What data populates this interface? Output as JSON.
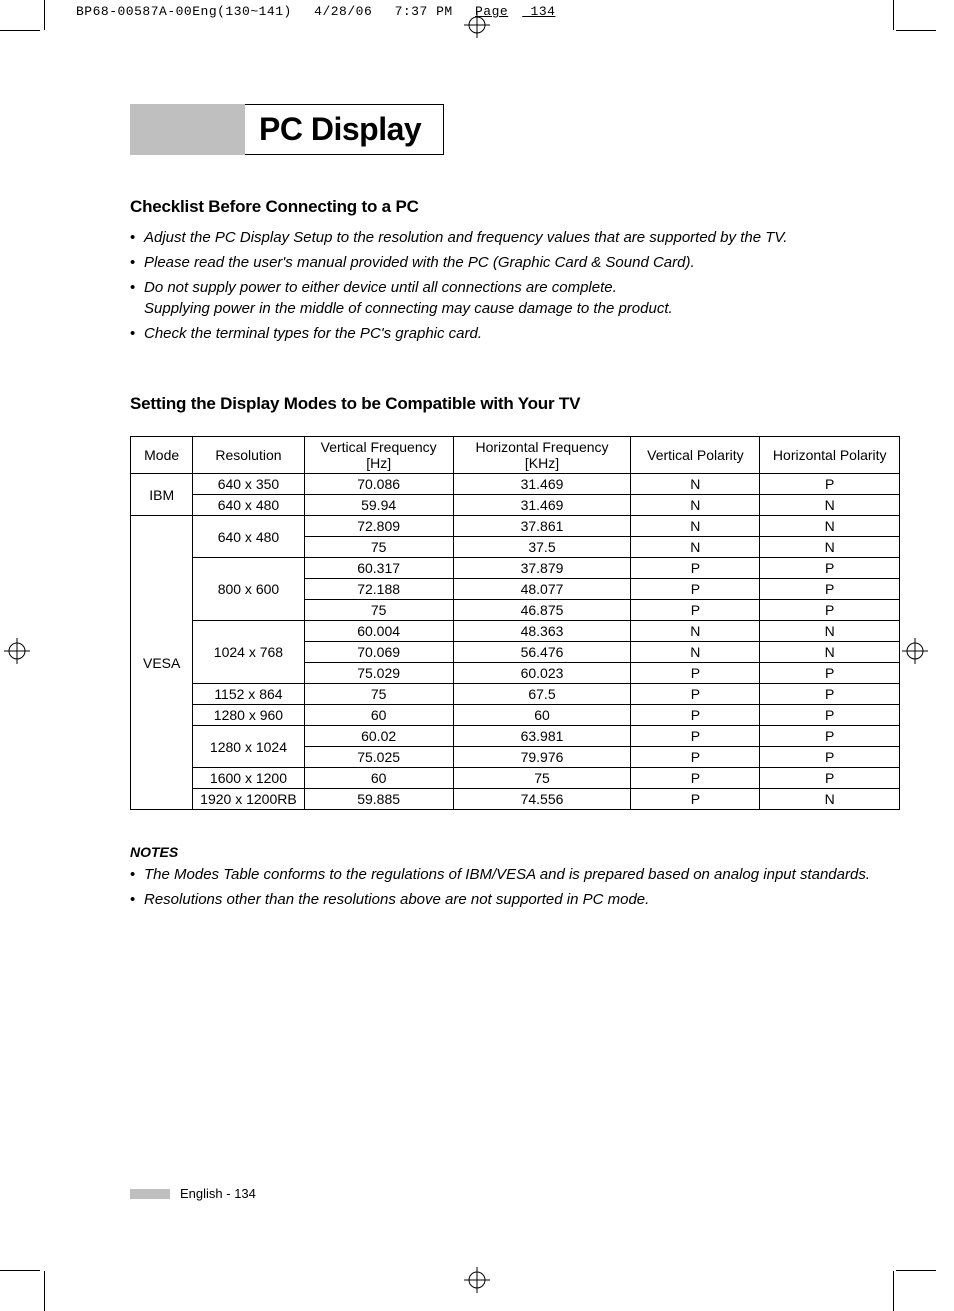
{
  "slug": {
    "file": "BP68-00587A-00Eng(130~141)",
    "date": "4/28/06",
    "time": "7:37 PM",
    "page_label": "Page",
    "page_num": "134"
  },
  "title": "PC Display",
  "checklist_heading": "Checklist Before Connecting to a PC",
  "checklist": [
    "Adjust the PC Display Setup to the resolution and frequency values that are supported by the TV.",
    "Please read the user's manual provided with the PC (Graphic Card & Sound Card).",
    "Do not supply power to either device until all connections are complete.",
    "Check the terminal types for the PC's graphic card."
  ],
  "checklist_sub_2": "Supplying power in the middle of connecting may cause damage to the product.",
  "table_heading": "Setting the Display Modes to be Compatible with Your TV",
  "table": {
    "headers": {
      "mode": "Mode",
      "resolution": "Resolution",
      "vfreq": "Vertical Frequency [Hz]",
      "hfreq": "Horizontal Frequency [KHz]",
      "vpol": "Vertical Polarity",
      "hpol": "Horizontal Polarity"
    },
    "modes": {
      "ibm": "IBM",
      "vesa": "VESA"
    },
    "rows": [
      {
        "res": "640 x 350",
        "vf": "70.086",
        "hf": "31.469",
        "vp": "N",
        "hp": "P"
      },
      {
        "res": "640 x 480",
        "vf": "59.94",
        "hf": "31.469",
        "vp": "N",
        "hp": "N"
      },
      {
        "res": "640 x 480",
        "vf": "72.809",
        "hf": "37.861",
        "vp": "N",
        "hp": "N"
      },
      {
        "res": "",
        "vf": "75",
        "hf": "37.5",
        "vp": "N",
        "hp": "N"
      },
      {
        "res": "800 x 600",
        "vf": "60.317",
        "hf": "37.879",
        "vp": "P",
        "hp": "P"
      },
      {
        "res": "",
        "vf": "72.188",
        "hf": "48.077",
        "vp": "P",
        "hp": "P"
      },
      {
        "res": "",
        "vf": "75",
        "hf": "46.875",
        "vp": "P",
        "hp": "P"
      },
      {
        "res": "1024 x 768",
        "vf": "60.004",
        "hf": "48.363",
        "vp": "N",
        "hp": "N"
      },
      {
        "res": "",
        "vf": "70.069",
        "hf": "56.476",
        "vp": "N",
        "hp": "N"
      },
      {
        "res": "",
        "vf": "75.029",
        "hf": "60.023",
        "vp": "P",
        "hp": "P"
      },
      {
        "res": "1152 x 864",
        "vf": "75",
        "hf": "67.5",
        "vp": "P",
        "hp": "P"
      },
      {
        "res": "1280 x 960",
        "vf": "60",
        "hf": "60",
        "vp": "P",
        "hp": "P"
      },
      {
        "res": "1280 x 1024",
        "vf": "60.02",
        "hf": "63.981",
        "vp": "P",
        "hp": "P"
      },
      {
        "res": "",
        "vf": "75.025",
        "hf": "79.976",
        "vp": "P",
        "hp": "P"
      },
      {
        "res": "1600 x 1200",
        "vf": "60",
        "hf": "75",
        "vp": "P",
        "hp": "P"
      },
      {
        "res": "1920 x 1200RB",
        "vf": "59.885",
        "hf": "74.556",
        "vp": "P",
        "hp": "N"
      }
    ]
  },
  "notes_heading": "NOTES",
  "notes": [
    "The Modes Table conforms to the regulations of IBM/VESA and is prepared based on analog input standards.",
    "Resolutions other than the resolutions above are not supported in PC mode."
  ],
  "footer": "English - 134"
}
